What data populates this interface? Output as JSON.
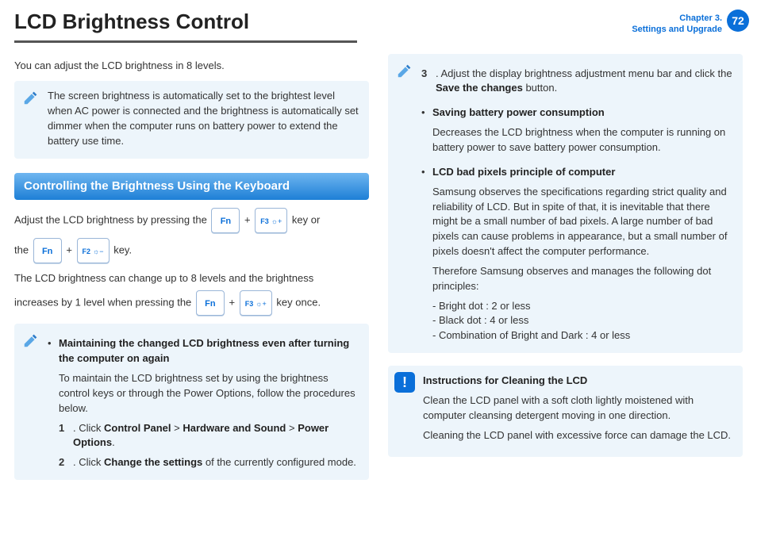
{
  "header": {
    "title": "LCD Brightness Control",
    "chapter_line1": "Chapter 3.",
    "chapter_line2": "Settings and Upgrade",
    "page_number": "72"
  },
  "left": {
    "intro": "You can adjust the LCD brightness in 8 levels.",
    "auto_note": "The screen brightness is automatically set to the brightest level when AC power is connected and the brightness is automatically set dimmer when the computer runs on battery power to extend the battery use time.",
    "section_heading": "Controlling the Brightness Using the Keyboard",
    "adjust_pre": "Adjust the LCD brightness by pressing the ",
    "plus": " + ",
    "key_or": " key or",
    "the": "the ",
    "key_period": " key.",
    "levels_pre": "The LCD brightness can change up to 8 levels and the brightness",
    "levels_post_pre": "increases by 1 level when pressing the ",
    "key_once": " key once.",
    "keys": {
      "fn": "Fn",
      "f3": "F3",
      "f2": "F2",
      "up": "☼+",
      "down": "☼−"
    },
    "maintain_heading": "Maintaining the changed LCD brightness even after turning the computer on again",
    "maintain_body": "To maintain the LCD brightness set by using the brightness control keys or through the Power Options, follow the procedures below.",
    "step1_n": "1",
    "step1_pre": ".  Click ",
    "step1_cp": "Control Panel",
    "gt": " > ",
    "step1_hw": "Hardware and Sound",
    "step1_po": "Power Options",
    "period": ".",
    "step2_n": "2",
    "step2_pre": ".  Click ",
    "step2_bold": "Change the settings",
    "step2_post": " of the currently configured mode."
  },
  "right": {
    "step3_n": "3",
    "step3_pre": ".  Adjust the display brightness adjustment menu bar and click the ",
    "step3_bold": "Save the changes",
    "step3_post": " button.",
    "battery_heading": "Saving battery power consumption",
    "battery_body": "Decreases the LCD brightness when the computer is running on battery power to save battery power consumption.",
    "badpx_heading": "LCD bad pixels principle of computer",
    "badpx_p1": "Samsung observes the specifications regarding strict quality and reliability of LCD. But in spite of that, it is inevitable that there might be a small number of bad pixels. A large number of bad pixels can cause problems in appearance, but a small number of pixels doesn't affect the computer performance.",
    "badpx_p2": "Therefore Samsung observes and manages the following dot principles:",
    "badpx_l1": "- Bright dot : 2 or less",
    "badpx_l2": "- Black dot  : 4 or less",
    "badpx_l3": "- Combination of Bright and Dark : 4 or less",
    "clean_heading": "Instructions for Cleaning the LCD",
    "clean_p1": "Clean the LCD panel with a soft cloth lightly moistened with computer cleansing detergent moving in one direction.",
    "clean_p2": "Cleaning the LCD panel with excessive force can damage the LCD."
  }
}
